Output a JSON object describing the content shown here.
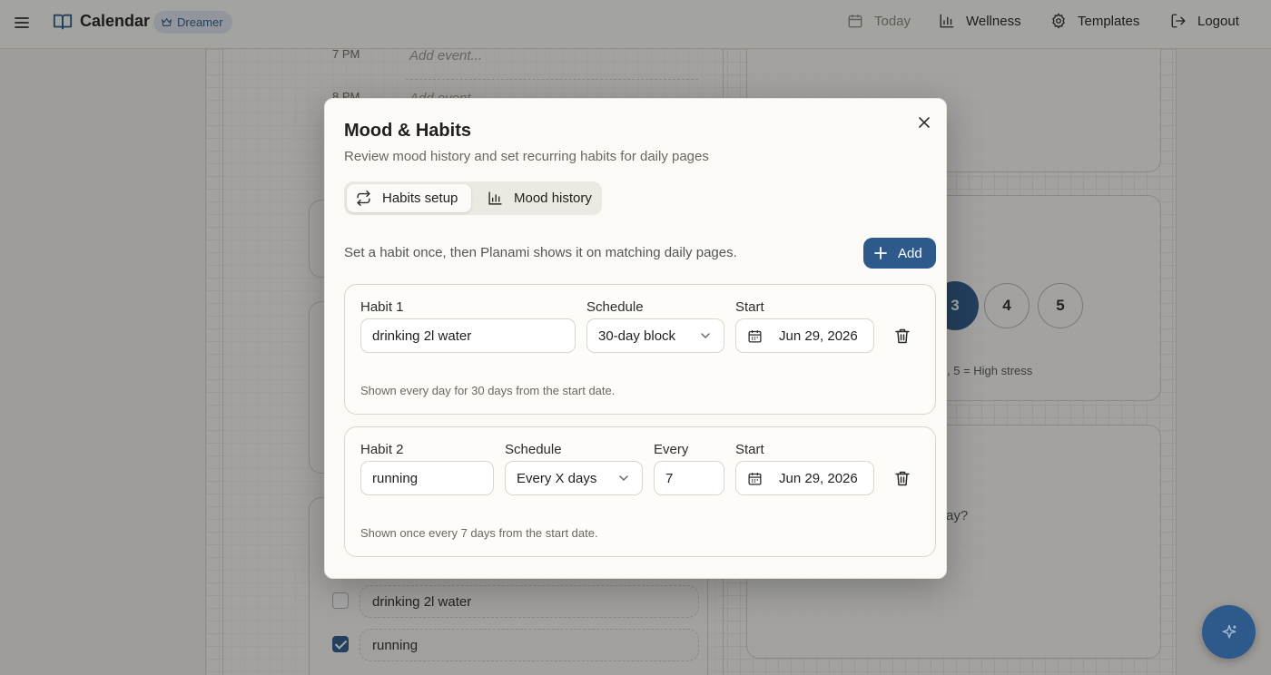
{
  "header": {
    "app_title": "Calendar",
    "badge_label": "Dreamer",
    "nav": [
      {
        "label": "Today",
        "icon": "calendar-icon"
      },
      {
        "label": "Wellness",
        "icon": "bar-chart-icon"
      },
      {
        "label": "Templates",
        "icon": "gear-icon"
      },
      {
        "label": "Logout",
        "icon": "logout-icon"
      }
    ]
  },
  "background": {
    "time_slots": [
      {
        "time": "7 PM",
        "placeholder": "Add event..."
      },
      {
        "time": "8 PM",
        "placeholder": "Add event..."
      }
    ],
    "stress_scale": [
      "3",
      "4",
      "5"
    ],
    "stress_selected": "3",
    "stress_caption": ", 5 = High stress",
    "question_fragment": "ay?",
    "daily_habits": [
      {
        "label": "drinking 2l water",
        "checked": false
      },
      {
        "label": "running",
        "checked": true
      }
    ]
  },
  "modal": {
    "title": "Mood & Habits",
    "subtitle": "Review mood history and set recurring habits for daily pages",
    "tabs": [
      {
        "label": "Habits setup",
        "active": true
      },
      {
        "label": "Mood history",
        "active": false
      }
    ],
    "intro": "Set a habit once, then Planami shows it on matching daily pages.",
    "add_label": "Add",
    "habits": [
      {
        "label": "Habit 1",
        "name_value": "drinking 2l water",
        "schedule_label": "Schedule",
        "schedule_value": "30-day block",
        "start_label": "Start",
        "start_value": "Jun 29, 2026",
        "note": "Shown every day for 30 days from the start date."
      },
      {
        "label": "Habit 2",
        "name_value": "running",
        "schedule_label": "Schedule",
        "schedule_value": "Every X days",
        "every_label": "Every",
        "every_value": "7",
        "start_label": "Start",
        "start_value": "Jun 29, 2026",
        "note": "Shown once every 7 days from the start date."
      }
    ]
  },
  "colors": {
    "accent": "#2d5a8a",
    "background": "#f3f1ea",
    "modal_bg": "#fbfaf6"
  }
}
